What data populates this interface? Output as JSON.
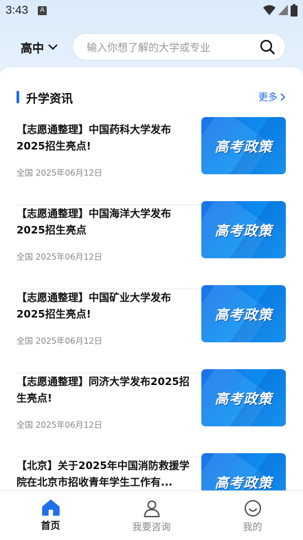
{
  "status_bar": {
    "time": "3:43",
    "notification_badge": "A",
    "icons": [
      "wifi-icon",
      "signal-icon",
      "battery-icon"
    ]
  },
  "header": {
    "grade_selected": "高中",
    "search_placeholder": "输入你想了解的大学或专业"
  },
  "section": {
    "title": "升学资讯",
    "more_label": "更多"
  },
  "articles": [
    {
      "title": "【志愿通整理】中国药科大学发布2025招生亮点!",
      "meta": "全国 2025年06月12日",
      "thumb_text": "高考政策"
    },
    {
      "title": "【志愿通整理】中国海洋大学发布2025招生亮点",
      "meta": "全国 2025年06月12日",
      "thumb_text": "高考政策"
    },
    {
      "title": "【志愿通整理】中国矿业大学发布2025招生亮点!",
      "meta": "全国 2025年06月12日",
      "thumb_text": "高考政策"
    },
    {
      "title": "【志愿通整理】同济大学发布2025招生亮点!",
      "meta": "全国 2025年06月12日",
      "thumb_text": "高考政策"
    },
    {
      "title": "【北京】关于2025年中国消防救援学院在北京市招收青年学生工作有...",
      "meta": "",
      "thumb_text": "高考政策"
    }
  ],
  "bottom_nav": {
    "items": [
      {
        "label": "首页",
        "icon": "home-icon",
        "active": true
      },
      {
        "label": "我要咨询",
        "icon": "person-icon",
        "active": false
      },
      {
        "label": "我的",
        "icon": "smiley-icon",
        "active": false
      }
    ]
  },
  "colors": {
    "accent": "#1f6feb",
    "header_bg": "#dcebfb"
  }
}
